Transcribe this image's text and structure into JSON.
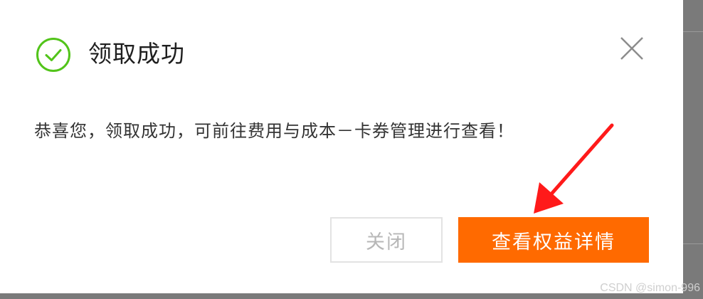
{
  "dialog": {
    "title": "领取成功",
    "message": "恭喜您，领取成功，可前往费用与成本－卡券管理进行查看！",
    "close_button_label": "关闭",
    "primary_button_label": "查看权益详情"
  },
  "icons": {
    "status": "check-circle-icon",
    "dismiss": "close-icon",
    "annotation": "red-arrow"
  },
  "watermark": "CSDN @simon-996",
  "colors": {
    "success": "#52c41a",
    "primary": "#ff6a00",
    "annotation": "#ff1a1a",
    "close_border": "#e3e3e3"
  }
}
